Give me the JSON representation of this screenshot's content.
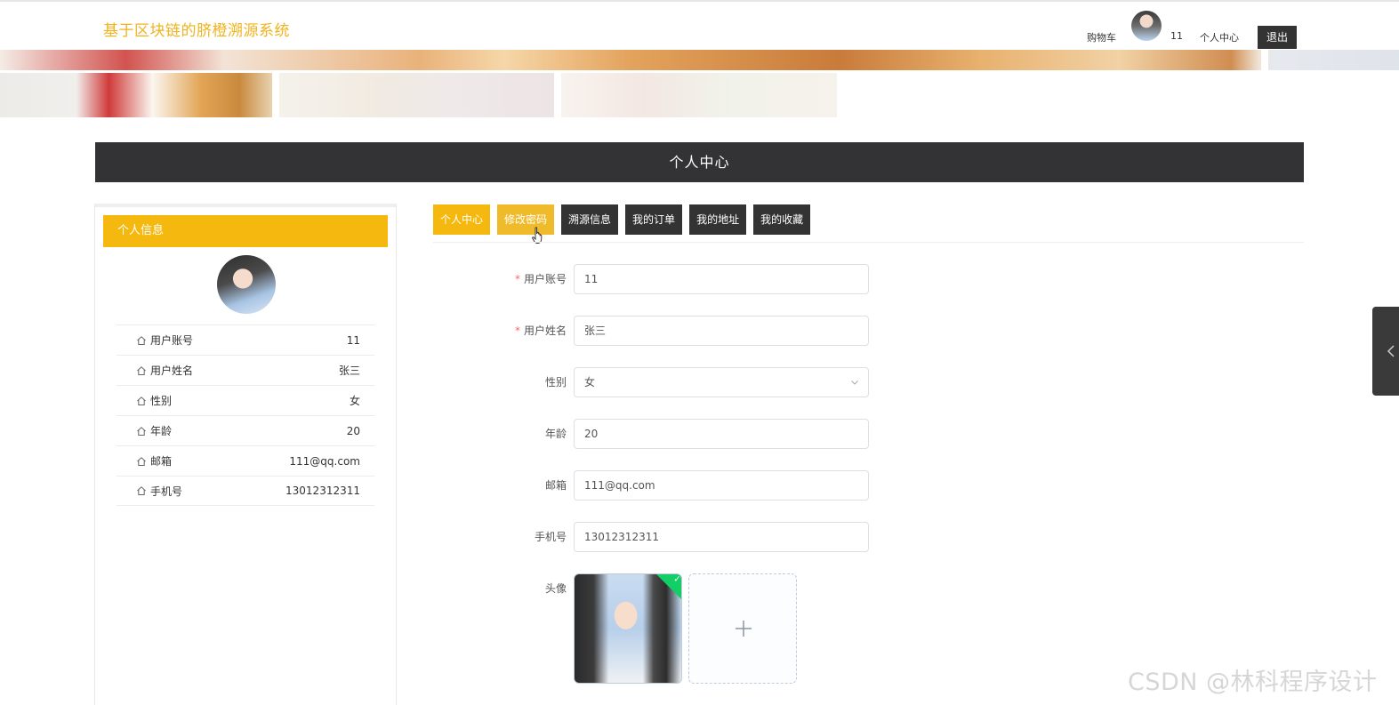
{
  "header": {
    "site_title": "基于区块链的脐橙溯源系统",
    "cart_label": "购物车",
    "username": "11",
    "center_label": "个人中心",
    "logout_label": "退出"
  },
  "page_title": "个人中心",
  "profile_panel": {
    "heading": "个人信息",
    "rows": [
      {
        "label": "用户账号",
        "value": "11"
      },
      {
        "label": "用户姓名",
        "value": "张三"
      },
      {
        "label": "性别",
        "value": "女"
      },
      {
        "label": "年龄",
        "value": "20"
      },
      {
        "label": "邮箱",
        "value": "111@qq.com"
      },
      {
        "label": "手机号",
        "value": "13012312311"
      }
    ]
  },
  "tabs": [
    {
      "label": "个人中心",
      "active": true
    },
    {
      "label": "修改密码",
      "active": false
    },
    {
      "label": "溯源信息",
      "active": false
    },
    {
      "label": "我的订单",
      "active": false
    },
    {
      "label": "我的地址",
      "active": false
    },
    {
      "label": "我的收藏",
      "active": false
    }
  ],
  "form": {
    "account": {
      "label": "用户账号",
      "value": "11",
      "required": true
    },
    "name": {
      "label": "用户姓名",
      "value": "张三",
      "required": true
    },
    "gender": {
      "label": "性别",
      "value": "女"
    },
    "age": {
      "label": "年龄",
      "value": "20"
    },
    "email": {
      "label": "邮箱",
      "value": "111@qq.com"
    },
    "phone": {
      "label": "手机号",
      "value": "13012312311"
    },
    "avatar": {
      "label": "头像"
    },
    "required_mark": "*"
  },
  "colors": {
    "accent": "#f5b80e",
    "dark": "#333336",
    "title": "#f0b31c"
  },
  "icons": [
    "home-icon",
    "chevron-down-icon",
    "plus-icon",
    "check-icon",
    "chevron-left-icon",
    "pointer-cursor-icon"
  ],
  "watermark": "CSDN @林科程序设计"
}
